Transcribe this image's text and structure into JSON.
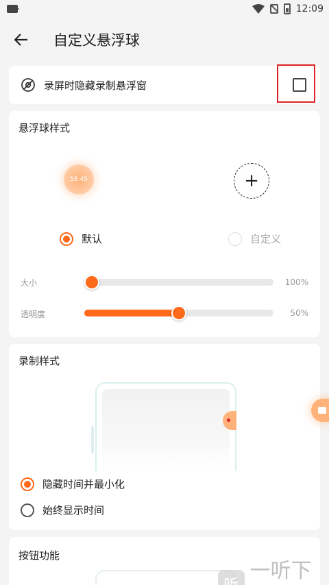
{
  "status": {
    "time": "12:09"
  },
  "header": {
    "title": "自定义悬浮球"
  },
  "hide_option": {
    "label": "录屏时隐藏录制悬浮窗",
    "checked": false
  },
  "ball_style": {
    "title": "悬浮球样式",
    "preview_time": "58:45",
    "add_symbol": "+",
    "options": [
      {
        "label": "默认",
        "selected": true
      },
      {
        "label": "自定义",
        "selected": false
      }
    ],
    "size": {
      "label": "大小",
      "value": 0,
      "display": "100%"
    },
    "opacity": {
      "label": "透明度",
      "value": 0.5,
      "display": "50%"
    }
  },
  "record_style": {
    "title": "录制样式",
    "options": [
      {
        "label": "隐藏时间并最小化",
        "selected": true
      },
      {
        "label": "始终显示时间",
        "selected": false
      }
    ]
  },
  "button_function": {
    "title": "按钮功能"
  },
  "watermark": {
    "logo": "听",
    "text": "一听下载"
  },
  "colors": {
    "accent": "#ff6a1a",
    "highlight_frame": "#e02020"
  }
}
